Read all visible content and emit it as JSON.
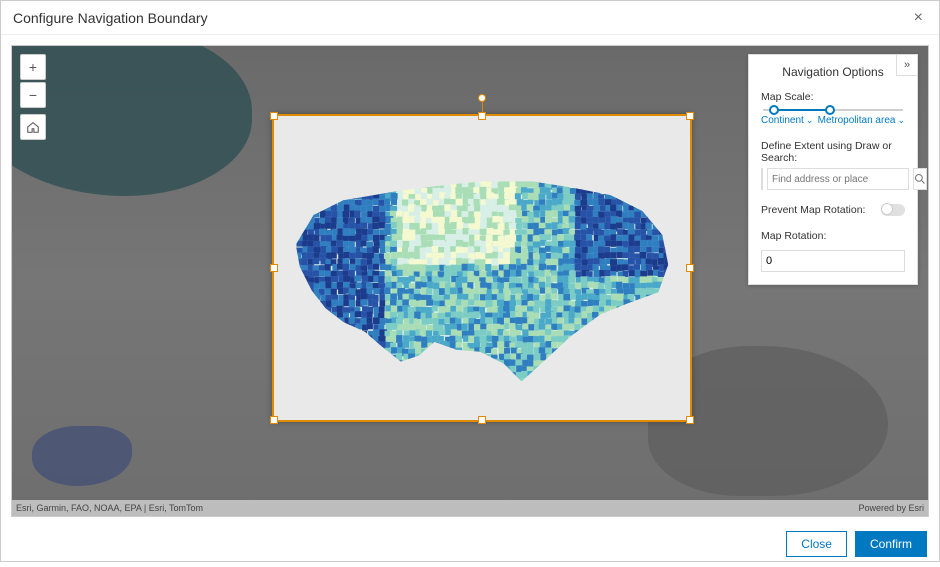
{
  "dialog": {
    "title": "Configure Navigation Boundary",
    "close_label": "×"
  },
  "zoom": {
    "in": "+",
    "out": "−",
    "home": "⌂"
  },
  "attribution": {
    "left": "Esri, Garmin, FAO, NOAA, EPA | Esri, TomTom",
    "right": "Powered by Esri"
  },
  "panel": {
    "title": "Navigation Options",
    "collapse_icon": "»",
    "map_scale_label": "Map Scale:",
    "scale_min_label": "Continent",
    "scale_max_label": "Metropolitan area",
    "extent_label": "Define Extent using Draw or Search:",
    "search_placeholder": "Find address or place",
    "prevent_rotation_label": "Prevent Map Rotation:",
    "rotation_label": "Map Rotation:",
    "rotation_value": "0"
  },
  "footer": {
    "close": "Close",
    "confirm": "Confirm"
  },
  "colors": {
    "accent": "#0079c1",
    "handle": "#e08a00"
  }
}
